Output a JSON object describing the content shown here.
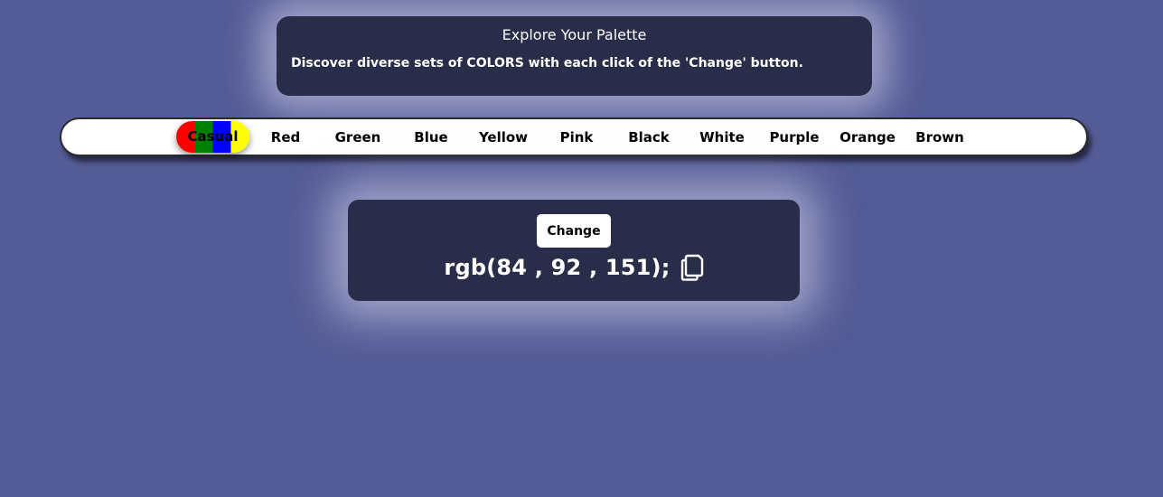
{
  "header": {
    "title": "Explore Your Palette",
    "subtitle": "Discover diverse sets of COLORS with each click of the 'Change' button."
  },
  "navbar": {
    "items": [
      {
        "label": "Casual",
        "active": true
      },
      {
        "label": "Red"
      },
      {
        "label": "Green"
      },
      {
        "label": "Blue"
      },
      {
        "label": "Yellow"
      },
      {
        "label": "Pink"
      },
      {
        "label": "Black"
      },
      {
        "label": "White"
      },
      {
        "label": "Purple"
      },
      {
        "label": "Orange"
      },
      {
        "label": "Brown"
      }
    ],
    "casual_gradient_colors": [
      "#ff0000",
      "#008000",
      "#0000ff",
      "#ffff00"
    ]
  },
  "color_panel": {
    "button_label": "Change",
    "rgb_text": "rgb(84 , 92 , 151);",
    "copy_icon": "copy-icon"
  },
  "colors": {
    "background": "#545c97",
    "card": "#2a2d4a"
  }
}
